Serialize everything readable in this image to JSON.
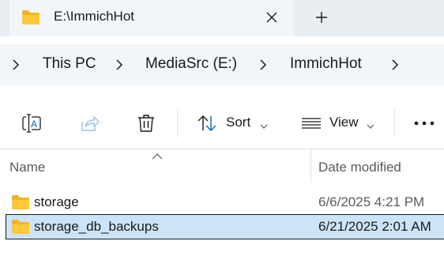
{
  "tab": {
    "title": "E:\\ImmichHot",
    "close_glyph": "✕",
    "new_tab_glyph": "+"
  },
  "breadcrumb": {
    "items": [
      "This PC",
      "MediaSrc (E:)",
      "ImmichHot"
    ]
  },
  "commands": {
    "sort_label": "Sort",
    "view_label": "View",
    "more_glyph": "•••"
  },
  "columns": {
    "name": "Name",
    "date_modified": "Date modified"
  },
  "files": [
    {
      "name": "storage",
      "date": "6/6/2025 4:21 PM",
      "selected": false
    },
    {
      "name": "storage_db_backups",
      "date": "6/21/2025 2:01 AM",
      "selected": true
    }
  ],
  "icons": {
    "folder": "folder-icon",
    "rename": "rename-icon",
    "share": "share-icon",
    "delete": "trash-icon",
    "sort": "sort-icon",
    "view": "view-icon",
    "more": "more-icon"
  },
  "colors": {
    "folder_yellow": "#ffc83d",
    "selection": "#cce4f7",
    "accent_blue": "#0067c0",
    "disabled_blue": "#9dc3e6"
  }
}
